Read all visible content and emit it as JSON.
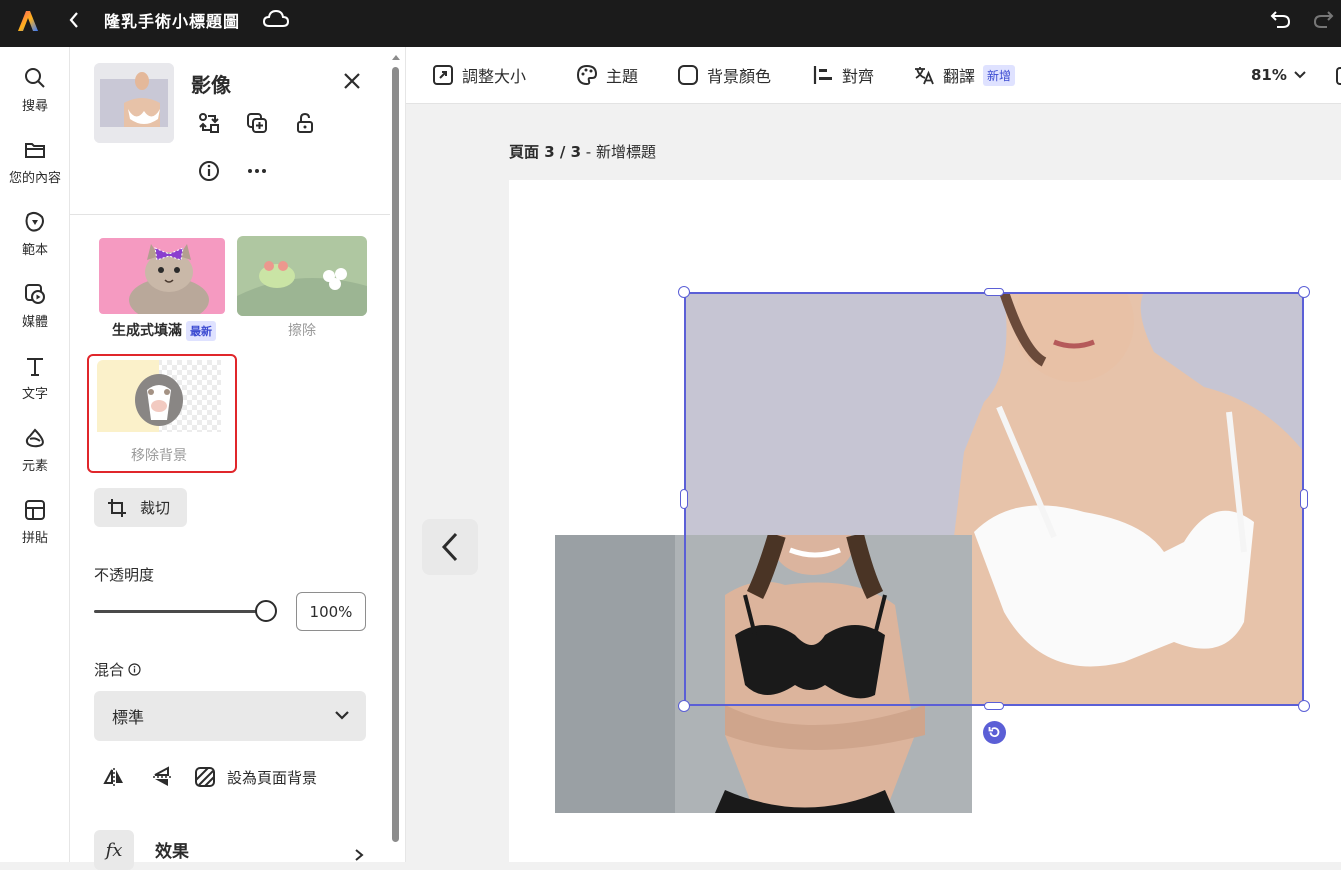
{
  "app": {
    "title": "隆乳手術小標題圖"
  },
  "rail": [
    {
      "label": "搜尋",
      "icon": "search-icon"
    },
    {
      "label": "您的內容",
      "icon": "folder-icon"
    },
    {
      "label": "範本",
      "icon": "template-icon"
    },
    {
      "label": "媒體",
      "icon": "media-icon"
    },
    {
      "label": "文字",
      "icon": "text-icon"
    },
    {
      "label": "元素",
      "icon": "shapes-icon"
    },
    {
      "label": "拼貼",
      "icon": "grid-icon"
    }
  ],
  "panel": {
    "title": "影像",
    "cards": {
      "fill_label": "生成式填滿",
      "fill_badge": "最新",
      "erase_label": "擦除",
      "remove_bg_label": "移除背景"
    },
    "crop_label": "裁切",
    "opacity_label": "不透明度",
    "opacity_value": "100%",
    "opacity_level": 1.0,
    "blend_label": "混合",
    "blend_value": "標準",
    "set_bg_label": "設為頁面背景",
    "effects_label": "效果",
    "effects_icon_text": "fx"
  },
  "toolbar": {
    "resize": "調整大小",
    "theme": "主題",
    "bg_color": "背景顏色",
    "align": "對齊",
    "translate": "翻譯",
    "translate_badge": "新增",
    "zoom": "81%"
  },
  "canvas": {
    "page_label_bold": "頁面 3 / 3",
    "page_label_rest": " - 新增標題"
  },
  "colors": {
    "accent": "#5b5fd6",
    "highlight": "#e0262b",
    "topbar": "#1b1b1b"
  }
}
